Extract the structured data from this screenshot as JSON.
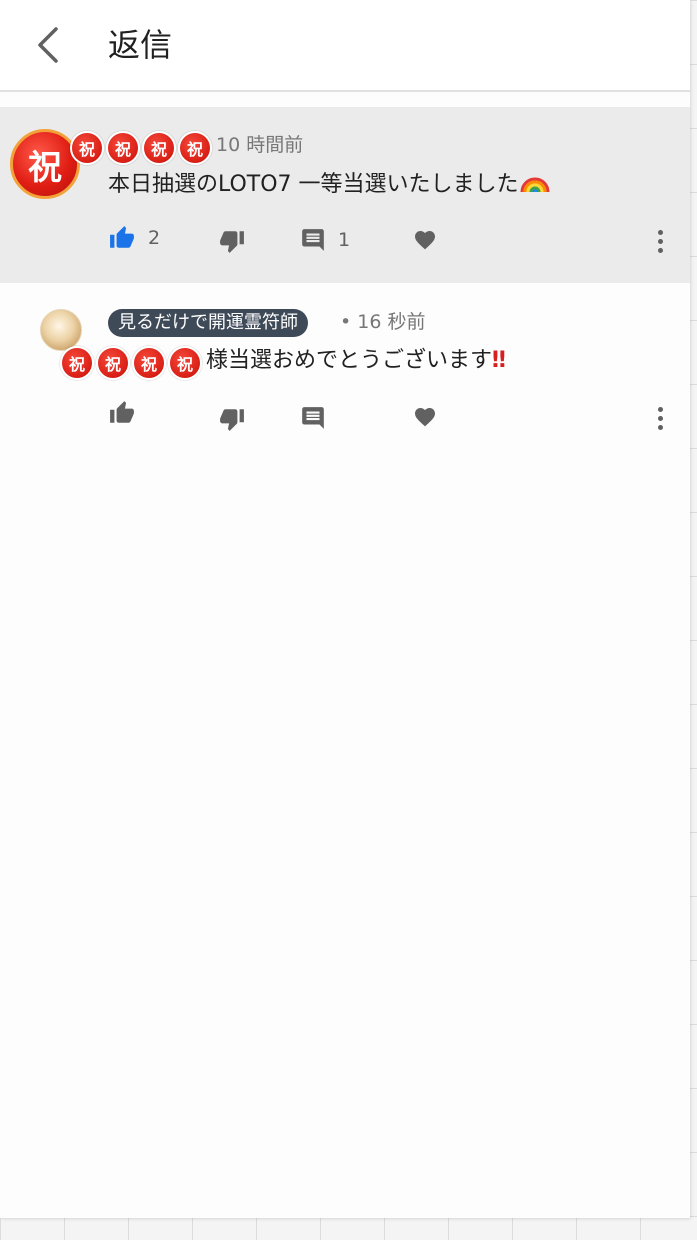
{
  "header": {
    "title": "返信"
  },
  "top_comment": {
    "author": "",
    "time": "10 時間前",
    "text": "本日抽選のLOTO7 一等当選いたしました",
    "text_emoji": "rainbow-emoji",
    "likes": "2",
    "replies": "1",
    "big_seal_char": "祝",
    "seal_chars": [
      "祝",
      "祝",
      "祝",
      "祝"
    ],
    "like_color": "#1a73e8"
  },
  "reply_comment": {
    "author": "見るだけで開運霊符師",
    "time": "• 16 秒前",
    "text_prefix": "様当選おめでとうございます",
    "text_suffix": "‼",
    "seal_chars": [
      "祝",
      "祝",
      "祝",
      "祝"
    ]
  },
  "colors": {
    "seal_red": "#d91f15",
    "chip_bg": "#3f4a59",
    "highlight_bg": "#ebebeb"
  }
}
